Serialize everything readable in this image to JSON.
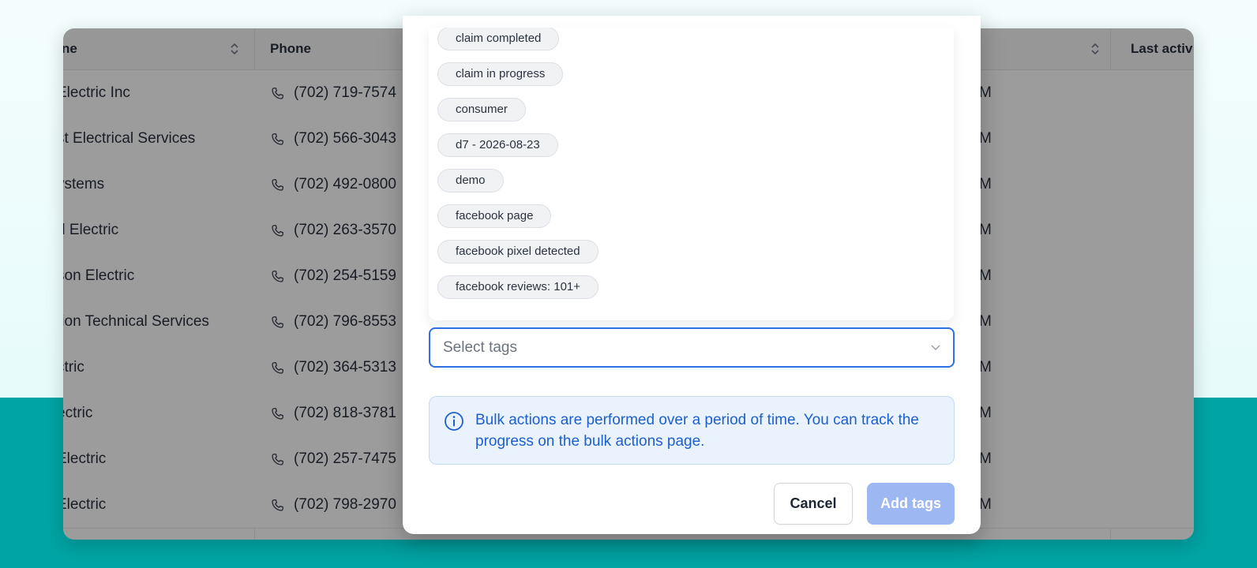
{
  "table": {
    "columns": {
      "name": "ne",
      "phone": "Phone",
      "last_activity": "Last activ"
    },
    "rows": [
      {
        "name": "Electric Inc",
        "phone": "(702) 719-7574",
        "time": "M"
      },
      {
        "name": "st Electrical Services",
        "phone": "(702) 566-3043",
        "time": "M"
      },
      {
        "name": "ystems",
        "phone": "(702) 492-0800",
        "time": "M"
      },
      {
        "name": "d Electric",
        "phone": "(702) 263-3570",
        "time": "M"
      },
      {
        "name": "son Electric",
        "phone": "(702) 254-5159",
        "time": "M"
      },
      {
        "name": "tion Technical Services",
        "phone": "(702) 796-8553",
        "time": "M"
      },
      {
        "name": "ctric",
        "phone": "(702) 364-5313",
        "time": "M"
      },
      {
        "name": "ectric",
        "phone": "(702) 818-3781",
        "time": "M"
      },
      {
        "name": "Electric",
        "phone": "(702) 257-7475",
        "time": "M"
      },
      {
        "name": "Electric",
        "phone": "(702) 798-2970",
        "time": "M"
      }
    ]
  },
  "modal": {
    "tag_options": [
      "claim completed",
      "claim in progress",
      "consumer",
      "d7 - 2026-08-23",
      "demo",
      "facebook page",
      "facebook pixel detected",
      "facebook reviews: 101+"
    ],
    "select": {
      "placeholder": "Select tags"
    },
    "info": {
      "text": "Bulk actions are performed over a period of time. You can track the progress on the bulk actions page."
    },
    "buttons": {
      "cancel": "Cancel",
      "add_tags": "Add tags"
    }
  },
  "colors": {
    "accent": "#2f6fe4",
    "add_button_disabled": "#9db7f3",
    "teal_background": "#00a3a3",
    "info_text": "#1d5fd0"
  }
}
